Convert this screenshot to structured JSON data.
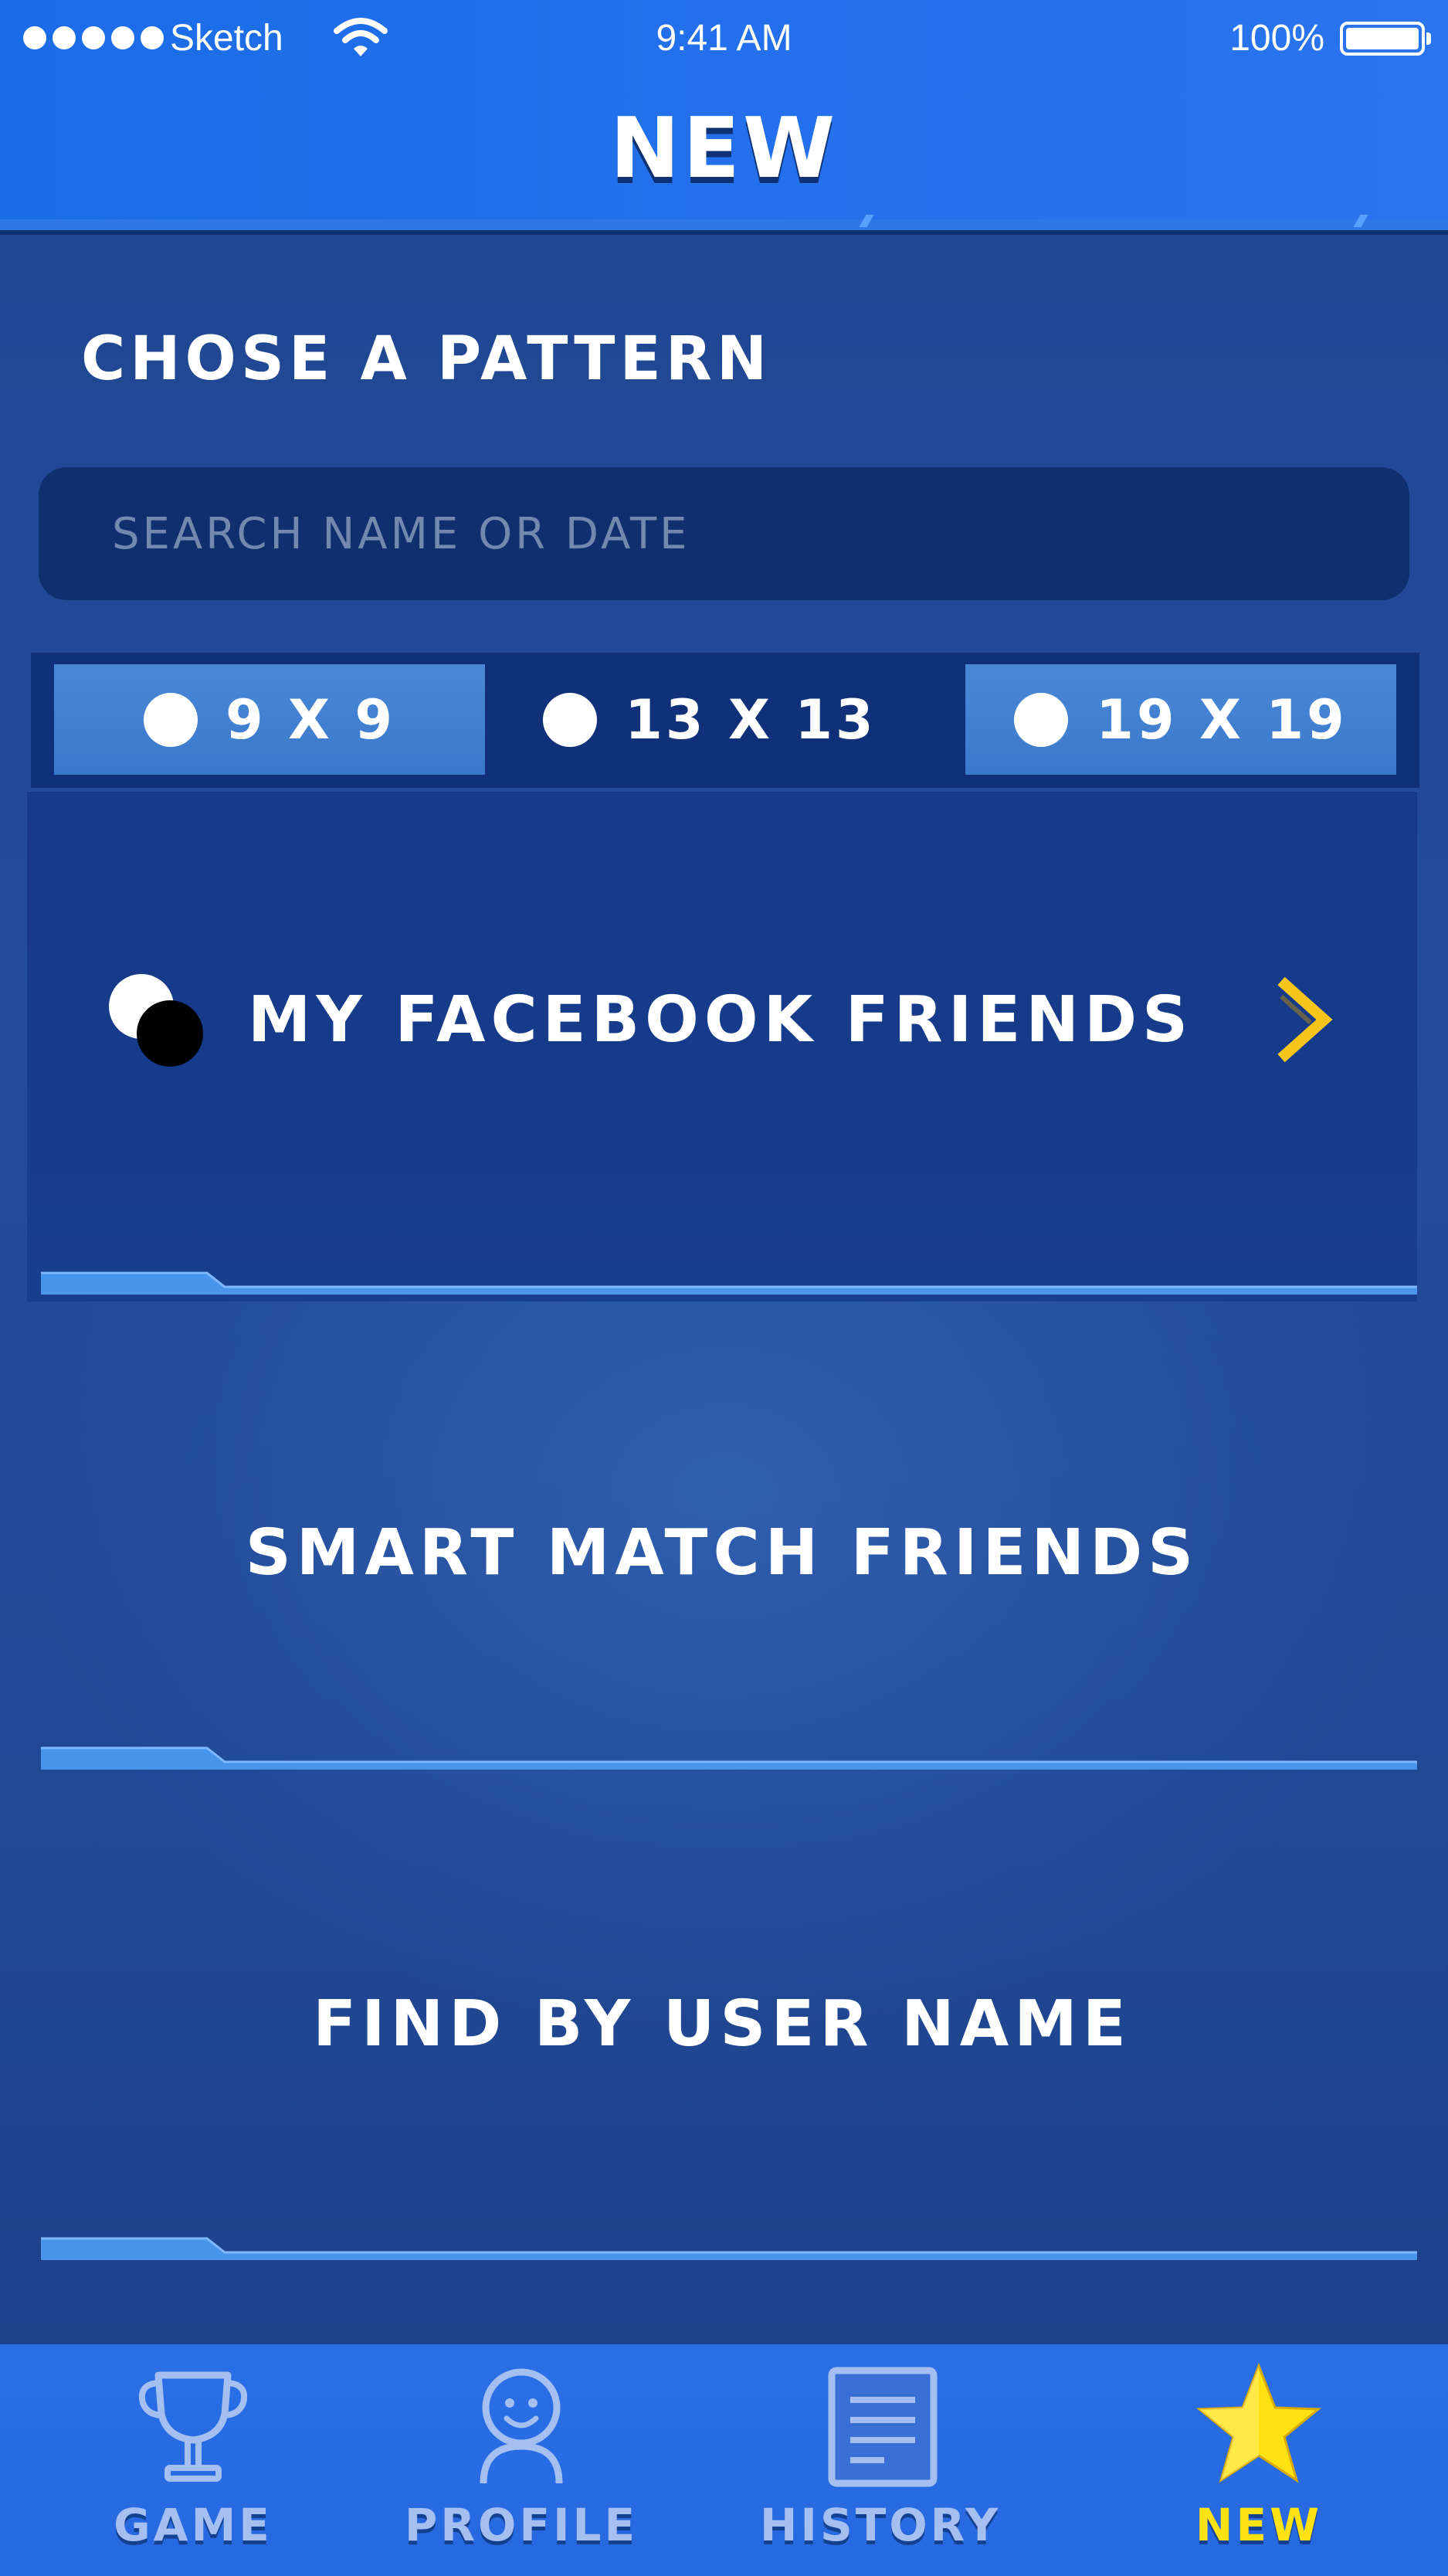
{
  "status_bar": {
    "carrier": "Sketch",
    "time": "9:41 AM",
    "battery": "100%"
  },
  "header": {
    "title": "NEW"
  },
  "pattern_section": {
    "title": "CHOSE A PATTERN"
  },
  "search": {
    "placeholder": "SEARCH NAME OR DATE",
    "value": ""
  },
  "board_sizes": [
    {
      "label": "9 X 9",
      "icon": "white-stone-icon"
    },
    {
      "label": "13 X 13",
      "icon": "white-stone-icon"
    },
    {
      "label": "19 X 19",
      "icon": "white-stone-icon"
    }
  ],
  "options": [
    {
      "label": "MY FACEBOOK FRIENDS",
      "icon": "go-stones-icon",
      "trailing_icon": "chevron-right-icon"
    },
    {
      "label": "SMART MATCH FRIENDS"
    },
    {
      "label": "FIND BY USER NAME"
    }
  ],
  "bottom_nav": [
    {
      "label": "GAME",
      "icon": "trophy-icon"
    },
    {
      "label": "PROFILE",
      "icon": "profile-icon"
    },
    {
      "label": "HISTORY",
      "icon": "history-icon"
    },
    {
      "label": "NEW",
      "icon": "star-icon",
      "active": true
    }
  ],
  "colors": {
    "background": "#1f4590",
    "header": "#2470ec",
    "search_bg": "#0f2f6e",
    "tab_raised": "#4a88d6",
    "accent_yellow": "#ffe212",
    "rail": "#4a95ec"
  }
}
